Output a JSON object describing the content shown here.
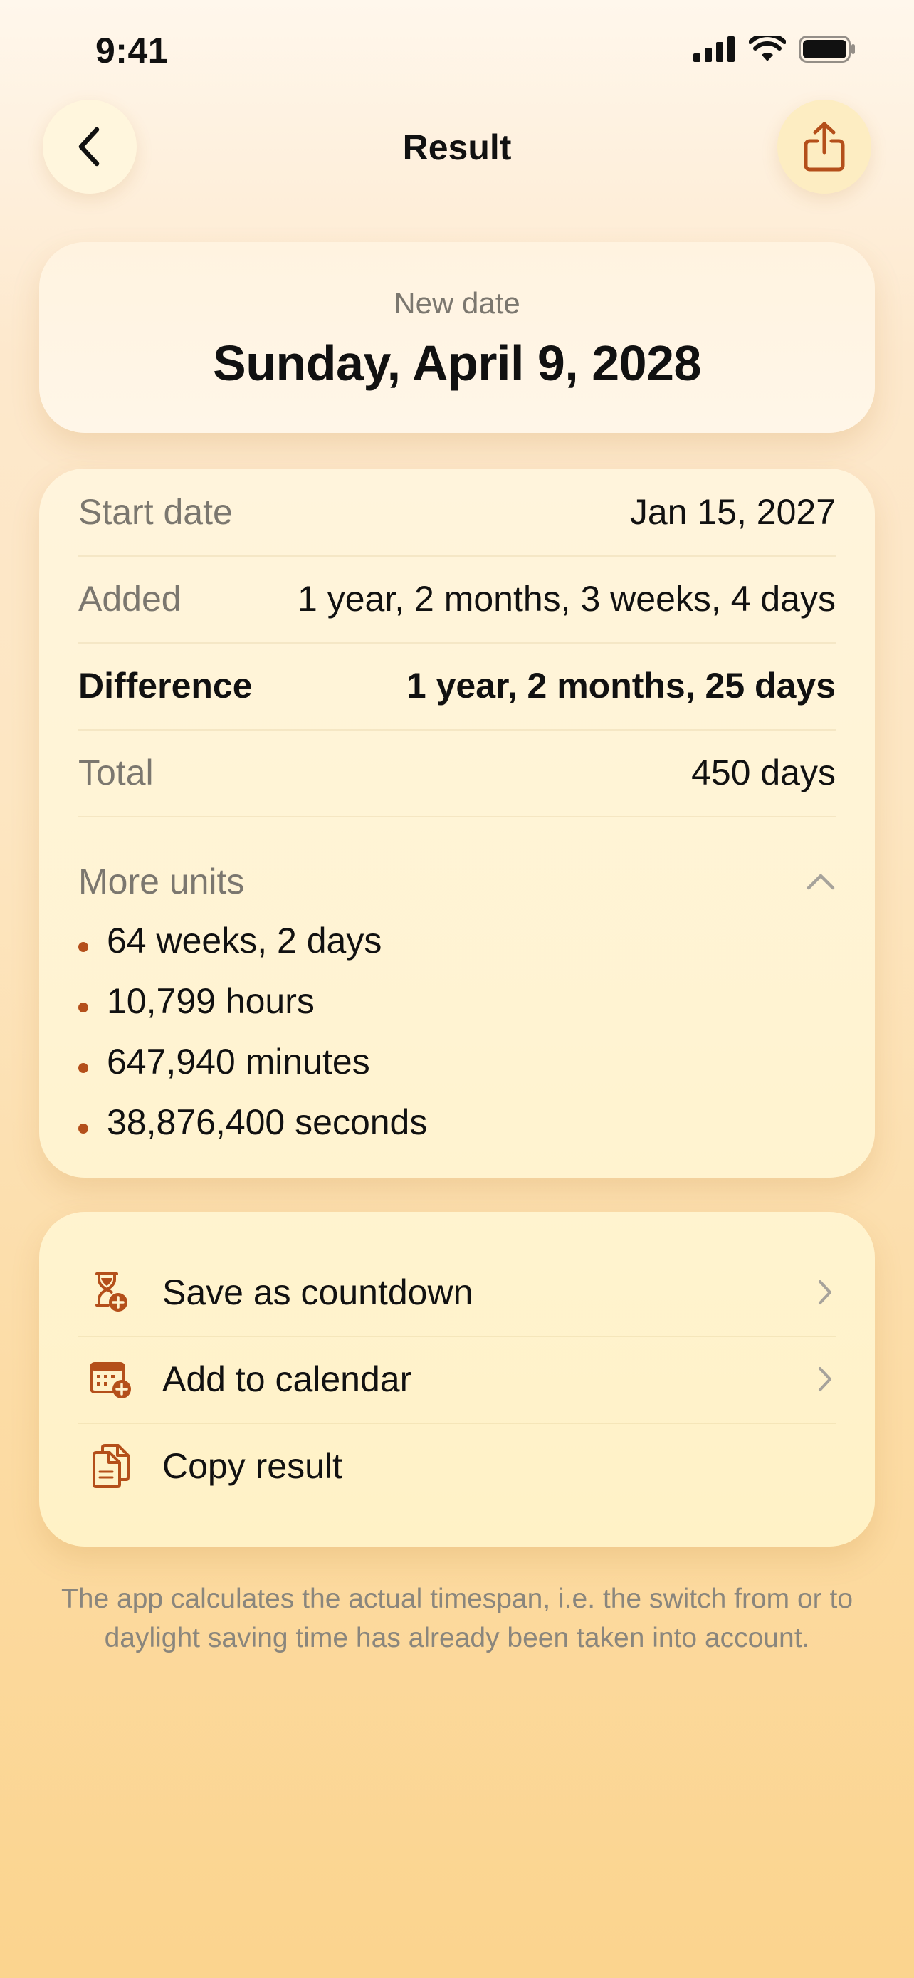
{
  "status_bar": {
    "time": "9:41"
  },
  "nav": {
    "title": "Result"
  },
  "result": {
    "label": "New date",
    "value": "Sunday, April 9, 2028"
  },
  "details": {
    "rows": [
      {
        "label": "Start date",
        "value": "Jan 15, 2027"
      },
      {
        "label": "Added",
        "value": "1 year, 2 months, 3 weeks, 4 days"
      },
      {
        "label": "Difference",
        "value": "1 year, 2 months, 25 days"
      },
      {
        "label": "Total",
        "value": "450 days"
      }
    ],
    "more_units": {
      "label": "More units",
      "items": [
        "64 weeks, 2 days",
        "10,799 hours",
        "647,940 minutes",
        "38,876,400 seconds"
      ]
    }
  },
  "actions": [
    {
      "label": "Save as countdown",
      "icon": "hourglass-add-icon"
    },
    {
      "label": "Add to calendar",
      "icon": "calendar-add-icon"
    },
    {
      "label": "Copy result",
      "icon": "copy-icon"
    }
  ],
  "footnote": "The app calculates the actual timespan, i.e. the switch from or to daylight saving time has already been taken into account.",
  "colors": {
    "accent": "#b44f1a",
    "secondary_text": "#7b776f",
    "chevron": "#a7a39b"
  }
}
